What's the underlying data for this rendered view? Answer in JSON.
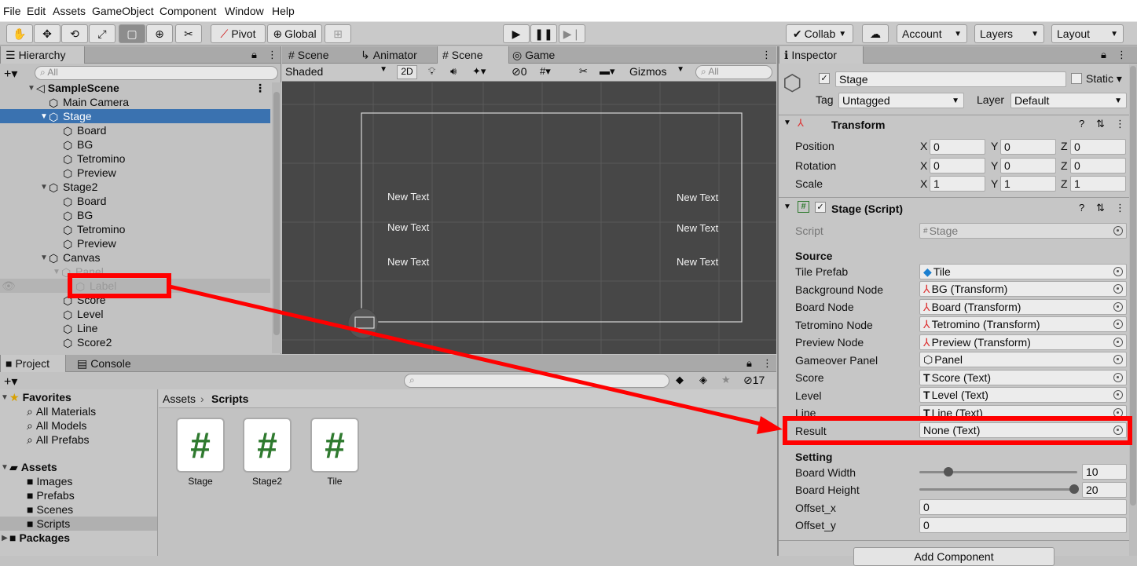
{
  "menu": [
    "File",
    "Edit",
    "Assets",
    "GameObject",
    "Component",
    "Window",
    "Help"
  ],
  "toolbar": {
    "pivot": "Pivot",
    "global": "Global",
    "collab": "Collab",
    "account": "Account",
    "layers": "Layers",
    "layout": "Layout"
  },
  "hierarchy": {
    "title": "Hierarchy",
    "search_placeholder": "All",
    "scene": "SampleScene",
    "items": [
      "Main Camera",
      "Stage",
      "Board",
      "BG",
      "Tetromino",
      "Preview",
      "Stage2",
      "Board",
      "BG",
      "Tetromino",
      "Preview",
      "Canvas",
      "Panel",
      "Label",
      "Score",
      "Level",
      "Line",
      "Score2"
    ]
  },
  "scene_tabs": {
    "t1": "Scene",
    "t2": "Animator",
    "t3": "Scene",
    "t4": "Game"
  },
  "scene_bar": {
    "shaded": "Shaded",
    "mode2d": "2D",
    "vis": "0",
    "gizmos": "Gizmos",
    "search": "All"
  },
  "scene_texts": [
    "New Text",
    "New Text",
    "New Text",
    "New Text",
    "New Text",
    "New Text"
  ],
  "project": {
    "tab1": "Project",
    "tab2": "Console",
    "count": "17",
    "breadcrumb_root": "Assets",
    "breadcrumb_leaf": "Scripts",
    "favorites": "Favorites",
    "fav_items": [
      "All Materials",
      "All Models",
      "All Prefabs"
    ],
    "assets": "Assets",
    "asset_folders": [
      "Images",
      "Prefabs",
      "Scenes",
      "Scripts"
    ],
    "packages": "Packages",
    "files": [
      "Stage",
      "Stage2",
      "Tile"
    ]
  },
  "inspector": {
    "title": "Inspector",
    "object_name": "Stage",
    "static": "Static",
    "tag_label": "Tag",
    "tag": "Untagged",
    "layer_label": "Layer",
    "layer": "Default",
    "transform": "Transform",
    "position": "Position",
    "rotation": "Rotation",
    "scale": "Scale",
    "pos": [
      "0",
      "0",
      "0"
    ],
    "rot": [
      "0",
      "0",
      "0"
    ],
    "scl": [
      "1",
      "1",
      "1"
    ],
    "axes": [
      "X",
      "Y",
      "Z"
    ],
    "script_comp": "Stage (Script)",
    "script_label": "Script",
    "script_value": "Stage",
    "source": "Source",
    "fields": [
      {
        "label": "Tile Prefab",
        "value": "Tile"
      },
      {
        "label": "Background Node",
        "value": "BG (Transform)"
      },
      {
        "label": "Board Node",
        "value": "Board (Transform)"
      },
      {
        "label": "Tetromino Node",
        "value": "Tetromino (Transform)"
      },
      {
        "label": "Preview Node",
        "value": "Preview (Transform)"
      },
      {
        "label": "Gameover Panel",
        "value": "Panel"
      },
      {
        "label": "Score",
        "value": "Score (Text)"
      },
      {
        "label": "Level",
        "value": "Level (Text)"
      },
      {
        "label": "Line",
        "value": "Line (Text)"
      },
      {
        "label": "Result",
        "value": "None (Text)"
      }
    ],
    "setting": "Setting",
    "board_width_label": "Board Width",
    "board_width": "10",
    "board_height_label": "Board Height",
    "board_height": "20",
    "offset_x_label": "Offset_x",
    "offset_x": "0",
    "offset_y_label": "Offset_y",
    "offset_y": "0",
    "add_component": "Add Component"
  }
}
